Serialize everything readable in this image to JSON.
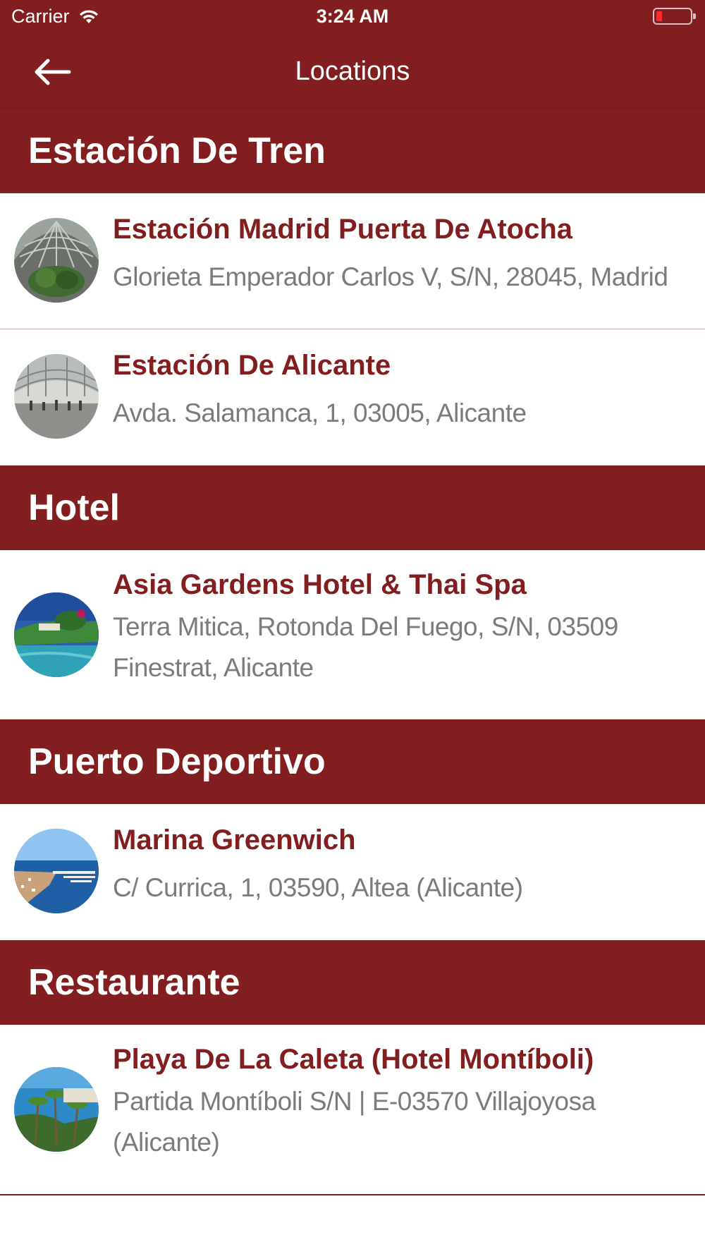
{
  "status_bar": {
    "carrier": "Carrier",
    "time": "3:24 AM"
  },
  "nav": {
    "title": "Locations",
    "back_icon": "back-arrow-icon"
  },
  "colors": {
    "brand": "#821e1f",
    "subtitle": "#7b7b7b",
    "background": "#ffffff"
  },
  "sections": [
    {
      "title": "Estación De Tren",
      "items": [
        {
          "name": "Estación Madrid Puerta De Atocha",
          "address": "Glorieta Emperador Carlos V, S/N, 28045, Madrid"
        },
        {
          "name": "Estación De Alicante",
          "address": "Avda. Salamanca, 1, 03005, Alicante"
        }
      ]
    },
    {
      "title": "Hotel",
      "items": [
        {
          "name": "Asia Gardens Hotel & Thai Spa",
          "address": "Terra Mitica, Rotonda Del Fuego, S/N, 03509 Finestrat, Alicante"
        }
      ]
    },
    {
      "title": "Puerto Deportivo",
      "items": [
        {
          "name": "Marina Greenwich",
          "address": "C/ Currica, 1, 03590, Altea (Alicante)"
        }
      ]
    },
    {
      "title": "Restaurante",
      "items": [
        {
          "name": "Playa De La Caleta (Hotel Montíboli)",
          "address": "Partida Montíboli S/N | E-03570 Villajoyosa (Alicante)"
        }
      ]
    }
  ]
}
